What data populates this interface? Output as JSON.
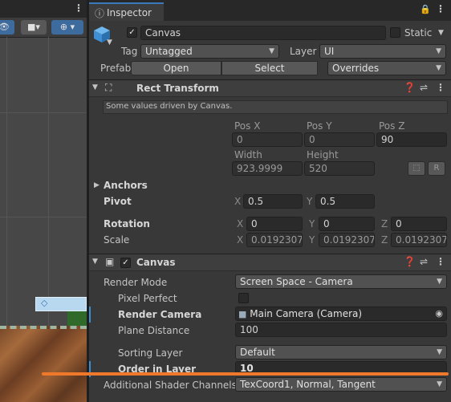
{
  "inspector": {
    "tab_title": "Inspector",
    "object_name": "Canvas",
    "static_label": "Static",
    "tag_label": "Tag",
    "tag_value": "Untagged",
    "layer_label": "Layer",
    "layer_value": "UI",
    "prefab_label": "Prefab",
    "open_label": "Open",
    "select_label": "Select",
    "overrides_label": "Overrides"
  },
  "rect_transform": {
    "title": "Rect Transform",
    "notice": "Some values driven by Canvas.",
    "pos_x_label": "Pos X",
    "pos_y_label": "Pos Y",
    "pos_z_label": "Pos Z",
    "pos_x": "0",
    "pos_y": "0",
    "pos_z": "90",
    "width_label": "Width",
    "height_label": "Height",
    "width": "923.9999",
    "height": "520",
    "r_label": "R",
    "anchors_label": "Anchors",
    "pivot_label": "Pivot",
    "pivot_x_axis": "X",
    "pivot_x": "0.5",
    "pivot_y_axis": "Y",
    "pivot_y": "0.5",
    "rotation_label": "Rotation",
    "rot_x": "0",
    "rot_y": "0",
    "rot_z": "0",
    "scale_label": "Scale",
    "scale_x": "0.0192307",
    "scale_y": "0.0192307",
    "scale_z": "0.0192307",
    "axis_x": "X",
    "axis_y": "Y",
    "axis_z": "Z"
  },
  "canvas": {
    "title": "Canvas",
    "render_mode_label": "Render Mode",
    "render_mode_value": "Screen Space - Camera",
    "pixel_perfect_label": "Pixel Perfect",
    "render_camera_label": "Render Camera",
    "render_camera_value": "Main Camera (Camera)",
    "plane_distance_label": "Plane Distance",
    "plane_distance_value": "100",
    "sorting_layer_label": "Sorting Layer",
    "sorting_layer_value": "Default",
    "order_in_layer_label": "Order in Layer",
    "order_in_layer_value": "10",
    "shader_channels_label": "Additional Shader Channels",
    "shader_channels_value": "TexCoord1, Normal, Tangent"
  },
  "colors": {
    "accent": "#3a79bb",
    "annotation_line": "#f0782a"
  }
}
